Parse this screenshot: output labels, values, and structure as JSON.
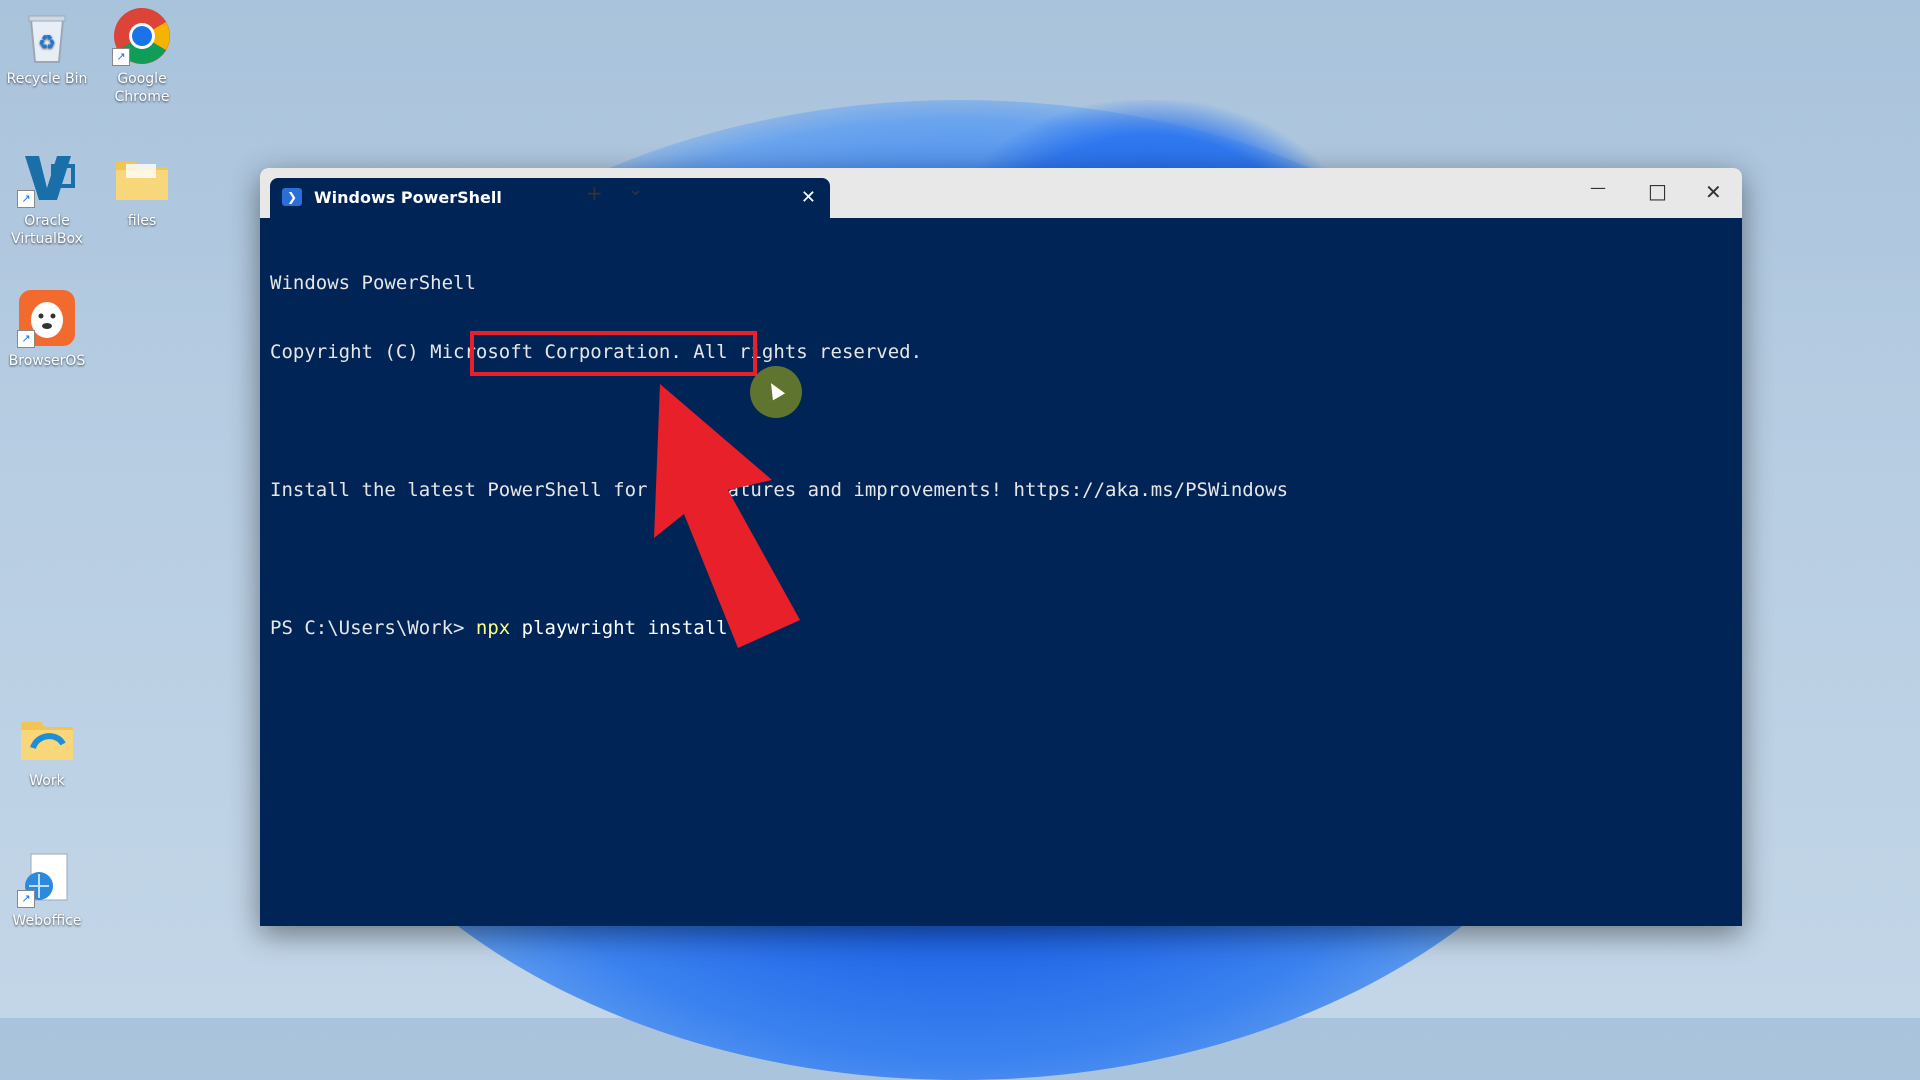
{
  "desktop": {
    "icons": [
      {
        "label_line1": "Recycle Bin",
        "label_line2": "",
        "icon": "recycle-bin-icon"
      },
      {
        "label_line1": "Google",
        "label_line2": "Chrome",
        "icon": "chrome-icon"
      },
      {
        "label_line1": "Oracle",
        "label_line2": "VirtualBox",
        "icon": "virtualbox-icon"
      },
      {
        "label_line1": "files",
        "label_line2": "",
        "icon": "folder-icon"
      },
      {
        "label_line1": "BrowserOS",
        "label_line2": "",
        "icon": "browseros-icon"
      },
      {
        "label_line1": "Work",
        "label_line2": "",
        "icon": "folder-icon"
      },
      {
        "label_line1": "Weboffice",
        "label_line2": "",
        "icon": "weboffice-icon"
      }
    ]
  },
  "window": {
    "tab_title": "Windows PowerShell",
    "new_tab_label": "+",
    "tab_close_label": "✕",
    "dropdown_label": "⌄",
    "minimize_label": "—",
    "maximize_label": "□",
    "close_label": "✕"
  },
  "terminal": {
    "line1": "Windows PowerShell",
    "line2": "Copyright (C) Microsoft Corporation. All rights reserved.",
    "line3": "",
    "line4": "Install the latest PowerShell for new features and improvements! https://aka.ms/PSWindows",
    "line5": "",
    "prompt": "PS C:\\Users\\Work> ",
    "command_npx": "npx",
    "command_rest": " playwright install"
  },
  "colors": {
    "terminal_bg": "#012456",
    "highlight": "#e8202a",
    "command_keyword": "#ffff80"
  }
}
